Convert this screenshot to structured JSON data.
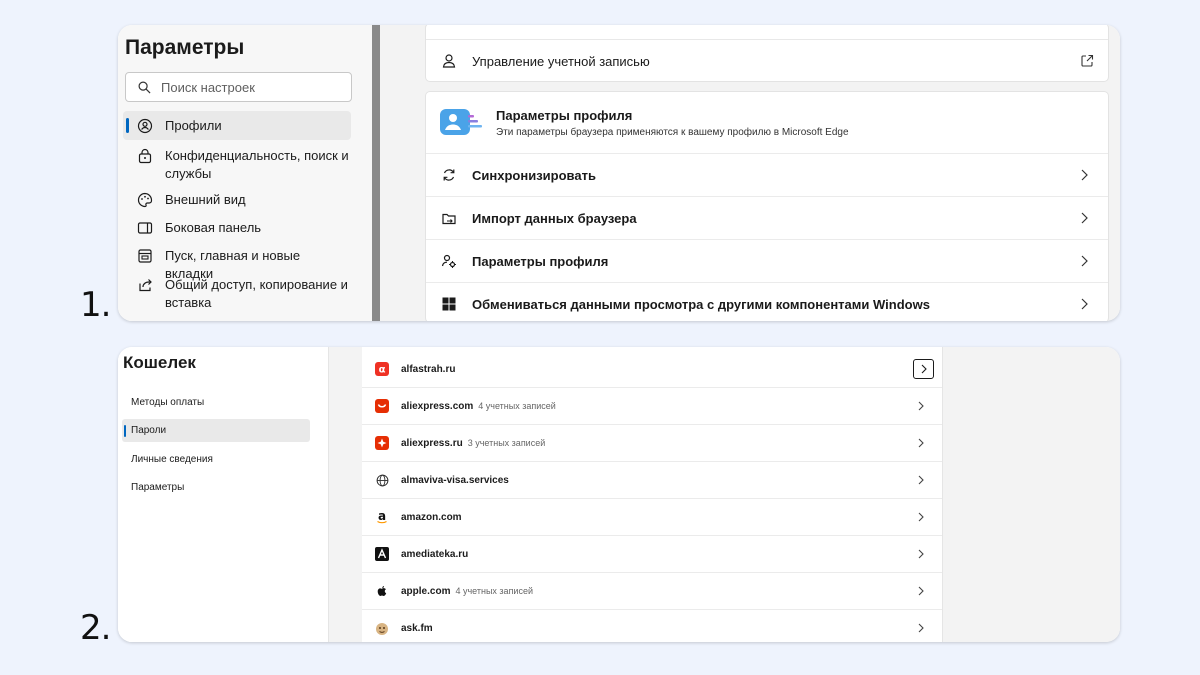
{
  "labels": {
    "step1": "1.",
    "step2": "2."
  },
  "settings": {
    "title": "Параметры",
    "search_placeholder": "Поиск настроек",
    "nav": [
      {
        "label": "Профили",
        "icon": "profile-icon",
        "active": true
      },
      {
        "label": "Конфиденциальность, поиск и службы",
        "icon": "lock-icon"
      },
      {
        "label": "Внешний вид",
        "icon": "palette-icon"
      },
      {
        "label": "Боковая панель",
        "icon": "sidebar-icon"
      },
      {
        "label": "Пуск, главная и новые вкладки",
        "icon": "home-tab-icon"
      },
      {
        "label": "Общий доступ, копирование и вставка",
        "icon": "share-icon"
      }
    ],
    "manage_account": "Управление учетной записью",
    "profile_card": {
      "title": "Параметры профиля",
      "subtitle": "Эти параметры браузера применяются к вашему профилю в Microsoft Edge"
    },
    "rows": [
      {
        "label": "Синхронизировать",
        "icon": "sync-icon"
      },
      {
        "label": "Импорт данных браузера",
        "icon": "import-icon"
      },
      {
        "label": "Параметры профиля",
        "icon": "profile-settings-icon"
      },
      {
        "label": "Обмениваться данными просмотра с другими компонентами Windows",
        "icon": "windows-icon"
      }
    ]
  },
  "wallet": {
    "title": "Кошелек",
    "nav": [
      {
        "label": "Методы оплаты"
      },
      {
        "label": "Пароли",
        "active": true
      },
      {
        "label": "Личные сведения"
      },
      {
        "label": "Параметры"
      }
    ],
    "sites": [
      {
        "domain": "alfastrah.ru",
        "count": "",
        "icon": "alfa-icon",
        "color": "#ef3124"
      },
      {
        "domain": "aliexpress.com",
        "count": "4 учетных записей",
        "icon": "aliexpress-icon",
        "color": "#e62e04"
      },
      {
        "domain": "aliexpress.ru",
        "count": "3 учетных записей",
        "icon": "aliexpress-ru-icon",
        "color": "#e62e04"
      },
      {
        "domain": "almaviva-visa.services",
        "count": "",
        "icon": "globe-icon",
        "color": "#333333"
      },
      {
        "domain": "amazon.com",
        "count": "",
        "icon": "amazon-icon",
        "color": "#111111"
      },
      {
        "domain": "amediateka.ru",
        "count": "",
        "icon": "amediateka-icon",
        "color": "#111111"
      },
      {
        "domain": "apple.com",
        "count": "4 учетных записей",
        "icon": "apple-icon",
        "color": "#111111"
      },
      {
        "domain": "ask.fm",
        "count": "",
        "icon": "askfm-icon",
        "color": "#c9a06a"
      }
    ]
  }
}
